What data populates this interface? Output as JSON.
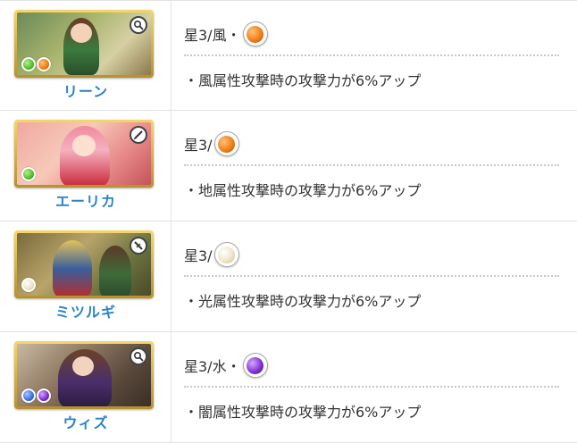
{
  "colors": {
    "name_blue": "#2a83c9",
    "wind_green": "#4fbf2a",
    "earth_orange": "#f07a12",
    "light_cream": "#ece3c6",
    "dark_purple": "#7a2ccf",
    "water_blue": "#3a6fe6"
  },
  "rows": [
    {
      "name": "リーン",
      "weapon_icon": "magnifier-icon",
      "card_elements": [
        "wind",
        "earth"
      ],
      "rarity": "星3/風・",
      "rarity_orb": "earth",
      "effect": "・風属性攻撃時の攻撃力が6%アップ"
    },
    {
      "name": "エーリカ",
      "weapon_icon": "pen-icon",
      "card_elements": [
        "wind"
      ],
      "rarity": "星3/",
      "rarity_orb": "earth",
      "effect": "・地属性攻撃時の攻撃力が6%アップ"
    },
    {
      "name": "ミツルギ",
      "weapon_icon": "sword-icon",
      "card_elements": [
        "light"
      ],
      "rarity": "星3/",
      "rarity_orb": "light",
      "effect": "・光属性攻撃時の攻撃力が6%アップ"
    },
    {
      "name": "ウィズ",
      "weapon_icon": "magnifier-icon",
      "card_elements": [
        "water",
        "dark"
      ],
      "rarity": "星3/水・",
      "rarity_orb": "dark",
      "effect": "・闇属性攻撃時の攻撃力が6%アップ"
    }
  ]
}
